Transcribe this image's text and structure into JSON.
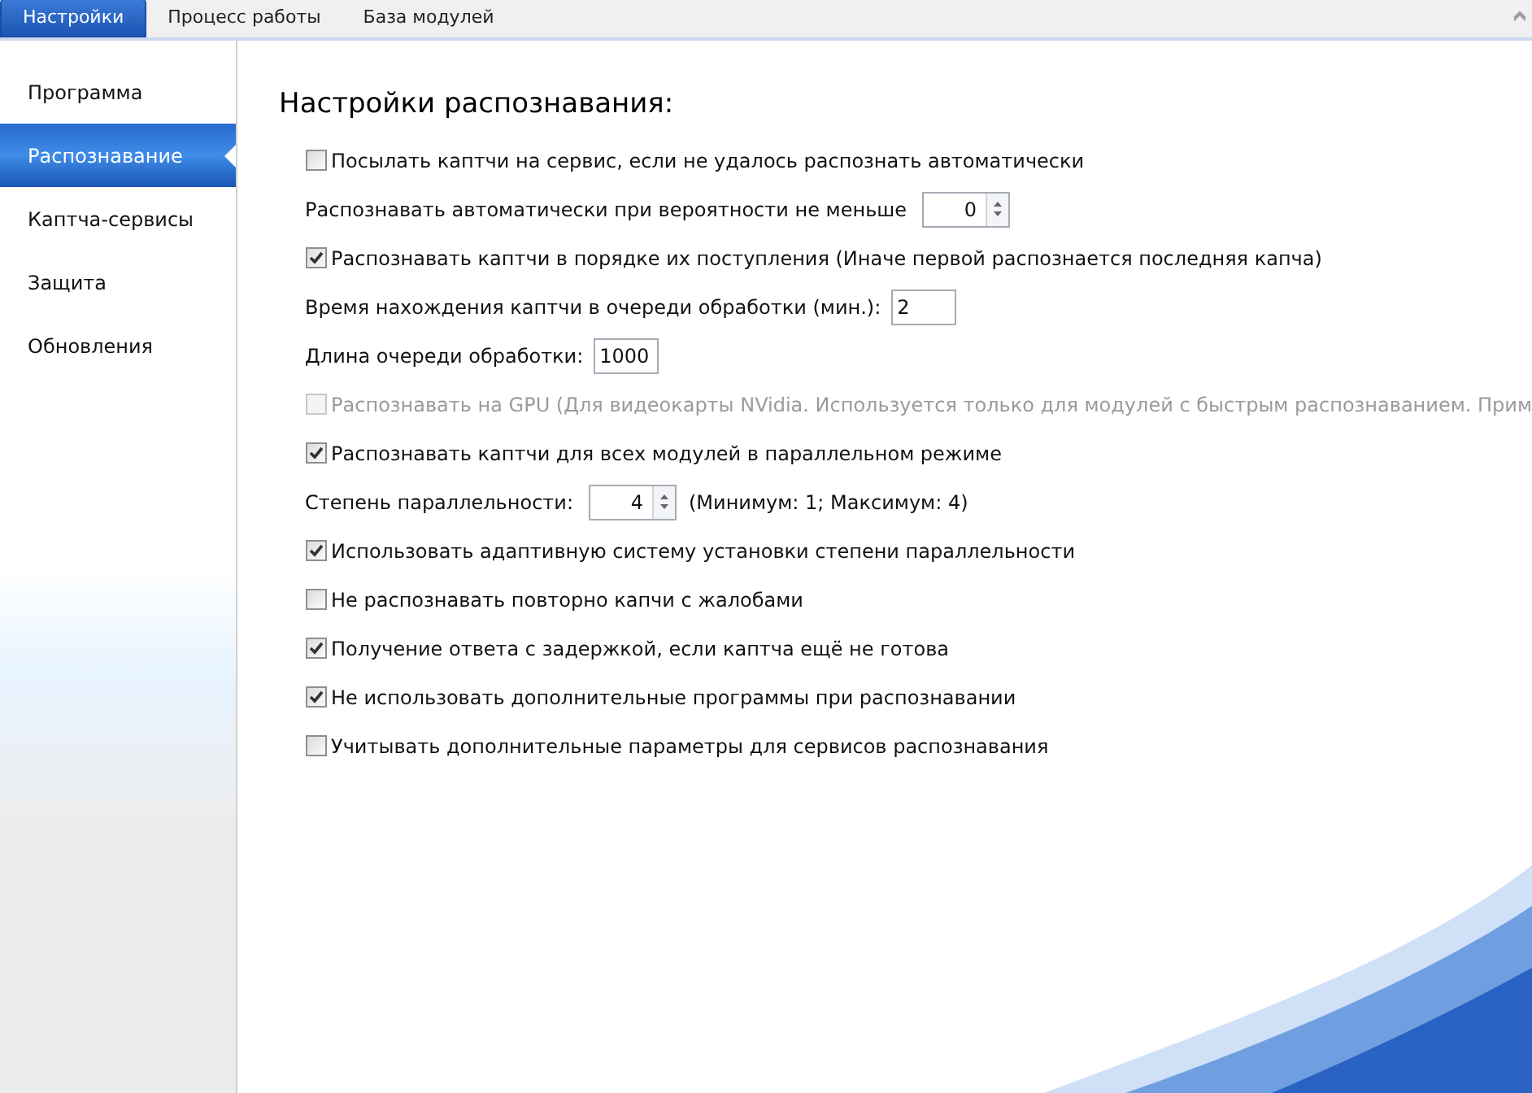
{
  "tabs": [
    {
      "label": "Настройки",
      "selected": true
    },
    {
      "label": "Процесс работы",
      "selected": false
    },
    {
      "label": "База модулей",
      "selected": false
    }
  ],
  "sidebar": {
    "items": [
      {
        "label": "Программа",
        "selected": false
      },
      {
        "label": "Распознавание",
        "selected": true
      },
      {
        "label": "Каптча-сервисы",
        "selected": false
      },
      {
        "label": "Защита",
        "selected": false
      },
      {
        "label": "Обновления",
        "selected": false
      }
    ]
  },
  "heading": "Настройки распознавания:",
  "rows": [
    {
      "kind": "checkbox",
      "label": "Посылать каптчи на сервис, если не удалось распознать автоматически",
      "checked": false,
      "disabled": false
    },
    {
      "kind": "spin",
      "label": "Распознавать автоматически при вероятности не меньше",
      "value": "0"
    },
    {
      "kind": "checkbox",
      "label": "Распознавать каптчи в порядке их поступления (Иначе первой распознается последняя капча)",
      "checked": true,
      "disabled": false
    },
    {
      "kind": "field",
      "label": "Время нахождения каптчи в очереди обработки (мин.):",
      "value": "2"
    },
    {
      "kind": "field",
      "label": "Длина очереди обработки:",
      "value": "1000"
    },
    {
      "kind": "checkbox",
      "label": "Распознавать на GPU (Для видеокарты NVidia. Используется только для модулей с быстрым распознаванием. Прим",
      "checked": false,
      "disabled": true
    },
    {
      "kind": "checkbox",
      "label": "Распознавать каптчи для всех модулей в параллельном режиме",
      "checked": true,
      "disabled": false
    },
    {
      "kind": "spin",
      "label": "Степень параллельности:",
      "value": "4",
      "note": "(Минимум: 1; Максимум: 4)"
    },
    {
      "kind": "checkbox",
      "label": "Использовать адаптивную систему установки степени параллельности",
      "checked": true,
      "disabled": false
    },
    {
      "kind": "checkbox",
      "label": "Не распознавать повторно капчи с жалобами",
      "checked": false,
      "disabled": false
    },
    {
      "kind": "checkbox",
      "label": "Получение ответа с задержкой, если каптча ещё не готова",
      "checked": true,
      "disabled": false
    },
    {
      "kind": "checkbox",
      "label": "Не использовать дополнительные программы при распознавании",
      "checked": true,
      "disabled": false
    },
    {
      "kind": "checkbox",
      "label": "Учитывать дополнительные параметры для сервисов распознавания",
      "checked": false,
      "disabled": false
    }
  ]
}
